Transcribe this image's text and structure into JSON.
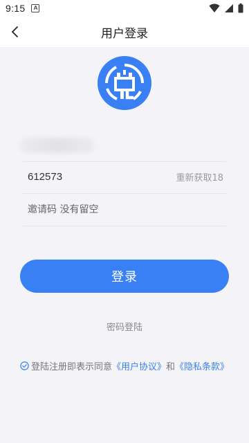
{
  "status_bar": {
    "time": "9:15",
    "notification_letter": "A"
  },
  "nav": {
    "title": "用户登录",
    "back_icon": "chevron-left-icon"
  },
  "logo": {
    "icon": "logo-badge-icon",
    "color": "#3a80f5"
  },
  "form": {
    "verification_code": "612573",
    "resend_label": "重新获取18",
    "invite_placeholder": "邀请码 没有留空"
  },
  "login_button_label": "登录",
  "password_login_label": "密码登陆",
  "agreement": {
    "prefix": "登陆注册即表示同意",
    "user_agreement": "《用户协议》",
    "and": "和",
    "privacy_policy": "《隐私条款》"
  },
  "colors": {
    "accent": "#3a80f5",
    "background": "#f4f4f8"
  }
}
